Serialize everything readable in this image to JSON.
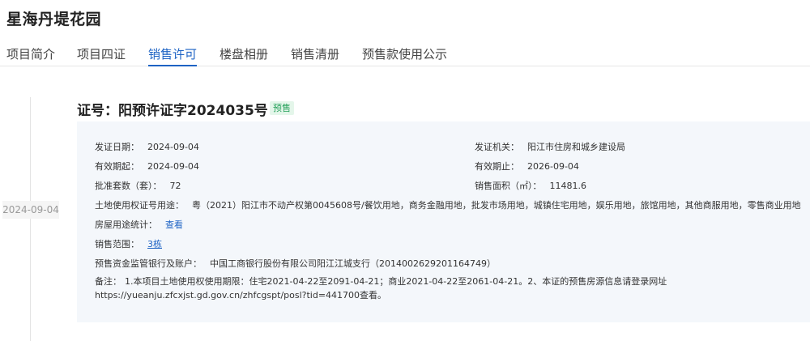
{
  "project": {
    "title": "星海丹堤花园"
  },
  "tabs": [
    {
      "label": "项目简介",
      "active": false
    },
    {
      "label": "项目四证",
      "active": false
    },
    {
      "label": "销售许可",
      "active": true
    },
    {
      "label": "楼盘相册",
      "active": false
    },
    {
      "label": "销售清册",
      "active": false
    },
    {
      "label": "预售款使用公示",
      "active": false
    }
  ],
  "timeline": {
    "date": "2024-09-04"
  },
  "certificate": {
    "heading": "证号：阳预许证字2024035号",
    "badge": "预售",
    "issue_date_label": "发证日期：",
    "issue_date": "2024-09-04",
    "authority_label": "发证机关：",
    "authority": "阳江市住房和城乡建设局",
    "valid_from_label": "有效期起：",
    "valid_from": "2024-09-04",
    "valid_to_label": "有效期止：",
    "valid_to": "2026-09-04",
    "units_label": "批准套数（套）：",
    "units": "72",
    "area_label": "销售面积（㎡）：",
    "area": "11481.6",
    "land_label": "土地使用权证号用途：",
    "land": "粤（2021）阳江市不动产权第0045608号/餐饮用地，商务金融用地，批发市场用地，城镇住宅用地，娱乐用地，旅馆用地，其他商服用地，零售商业用地",
    "usage_label": "房屋用途统计：",
    "usage_link": "查看",
    "scope_label": "销售范围：",
    "scope_link": "3栋",
    "bank_label": "预售资金监管银行及账户：",
    "bank": "中国工商银行股份有限公司阳江江城支行（2014002629201164749）",
    "remark_label": "备注：",
    "remark": "1.本项目土地使用权使用期限：住宅2021-04-22至2091-04-21；商业2021-04-22至2061-04-21。2、本证的预售房源信息请登录网址https://yueanju.zfcxjst.gd.gov.cn/zhfcgspt/posl?tid=441700查看。"
  },
  "colors": {
    "accent": "#1e63c4",
    "badge_text": "#25a05a",
    "badge_bg": "#e4f6ea",
    "panel_bg": "#f4f7fb"
  }
}
